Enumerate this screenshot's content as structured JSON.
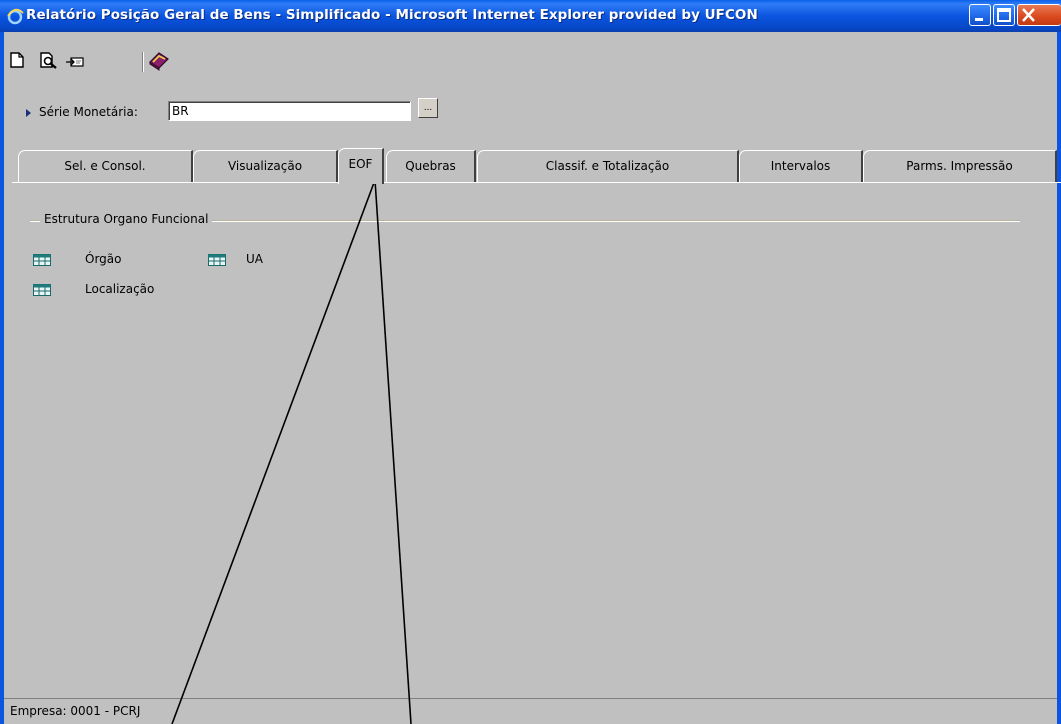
{
  "window": {
    "title": "Relatório Posição Geral de Bens - Simplificado - Microsoft Internet Explorer provided by UFCON"
  },
  "toolbar": {
    "icons": [
      "new-document-icon",
      "print-preview-icon",
      "export-icon",
      "help-book-icon"
    ]
  },
  "serie": {
    "label": "Série Monetária:",
    "value": "BR",
    "browse_label": "..."
  },
  "tabs": [
    {
      "label": "Sel. e Consol."
    },
    {
      "label": "Visualização"
    },
    {
      "label": "EOF",
      "active": true
    },
    {
      "label": "Quebras"
    },
    {
      "label": "Classif. e Totalização"
    },
    {
      "label": "Intervalos"
    },
    {
      "label": "Parms. Impressão"
    }
  ],
  "group": {
    "title": "Estrutura Organo Funcional",
    "items": [
      {
        "label": "Órgão"
      },
      {
        "label": "UA"
      },
      {
        "label": "Localização"
      }
    ]
  },
  "status": {
    "text": "Empresa: 0001 - PCRJ"
  },
  "colors": {
    "titlebar": "#0b55e0",
    "background": "#c0c0c0",
    "annotation_lines": "#000000"
  }
}
